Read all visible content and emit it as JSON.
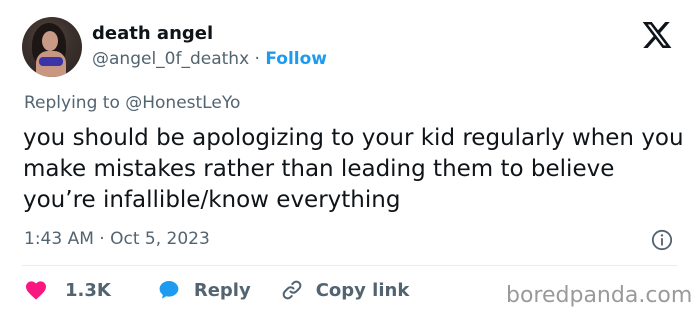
{
  "author": {
    "name": "death angel",
    "handle": "@angel_0f_deathx",
    "separator": "·",
    "follow_label": "Follow"
  },
  "replying_to": "Replying to @HonestLeYo",
  "tweet_text": "you should be apologizing to your kid regularly when you make mistakes rather than leading them to believe you’re infallible/know everything",
  "timestamp": "1:43 AM · Oct 5, 2023",
  "actions": {
    "likes_count": "1.3K",
    "reply_label": "Reply",
    "copy_link_label": "Copy link"
  },
  "watermark": "boredpanda.com",
  "colors": {
    "like": "#f91880",
    "reply": "#1d9bf0",
    "follow": "#1d9bf0",
    "muted": "#536471"
  },
  "icons": [
    "x-logo-icon",
    "info-icon",
    "heart-icon",
    "speech-bubble-icon",
    "link-icon"
  ]
}
